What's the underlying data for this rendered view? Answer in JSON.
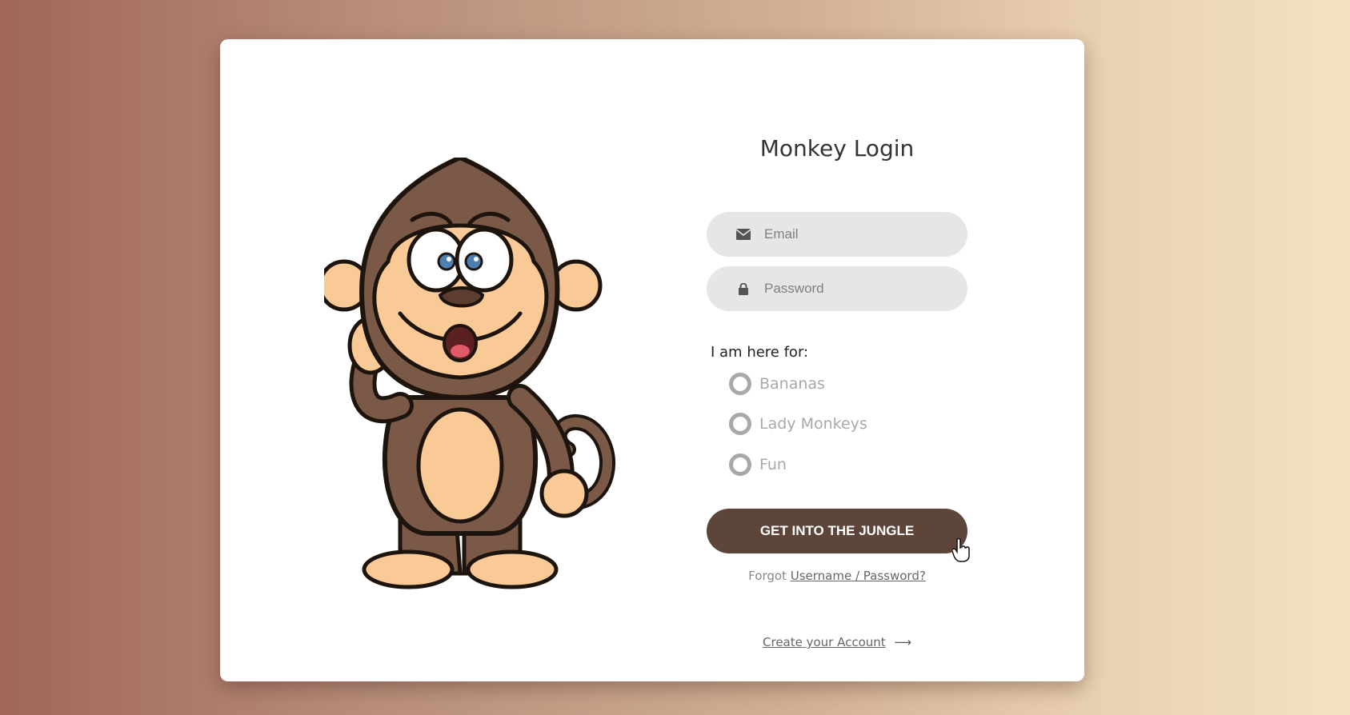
{
  "login": {
    "title": "Monkey Login",
    "email_placeholder": "Email",
    "password_placeholder": "Password",
    "purpose_label": "I am here for:",
    "options": [
      {
        "label": "Bananas",
        "selected": false
      },
      {
        "label": "Lady Monkeys",
        "selected": false
      },
      {
        "label": "Fun",
        "selected": false
      }
    ],
    "submit_label": "GET INTO THE JUNGLE",
    "forgot_prefix": "Forgot",
    "forgot_link": "Username / Password?",
    "create_link": "Create your Account",
    "create_arrow": "⟶"
  },
  "icons": {
    "email": "envelope-icon",
    "password": "lock-icon",
    "illustration": "monkey-illustration",
    "cursor": "hand-pointer-cursor"
  },
  "colors": {
    "button": "#5d4639",
    "field_bg": "#e6e6e6",
    "radio": "#a8a8a8"
  }
}
